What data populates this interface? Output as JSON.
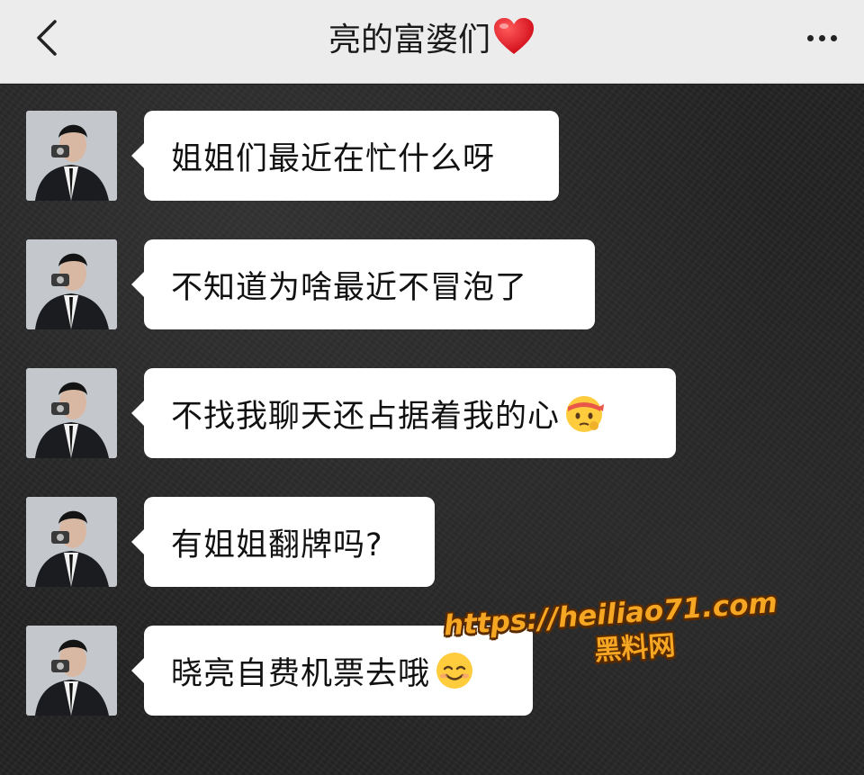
{
  "header": {
    "title": "亮的富婆们",
    "back_icon": "chevron-left-icon",
    "heart_icon": "red-heart-emoji",
    "more_icon": "more-dots-icon"
  },
  "messages": [
    {
      "text": "姐姐们最近在忙什么呀",
      "emoji": ""
    },
    {
      "text": "不知道为啥最近不冒泡了",
      "emoji": ""
    },
    {
      "text": "不找我聊天还占据着我的心",
      "emoji": "face-with-headband-thinking-emoji"
    },
    {
      "text": "有姐姐翻牌吗?",
      "emoji": ""
    },
    {
      "text": "晓亮自费机票去哦",
      "emoji": "smiling-face-emoji"
    }
  ],
  "watermark": {
    "url": "https://heiliao71.com",
    "name": "黑料网",
    "color": "#f5a623"
  },
  "colors": {
    "header_bg": "#ececec",
    "bubble_bg": "#ffffff",
    "chat_bg": "#232323"
  }
}
